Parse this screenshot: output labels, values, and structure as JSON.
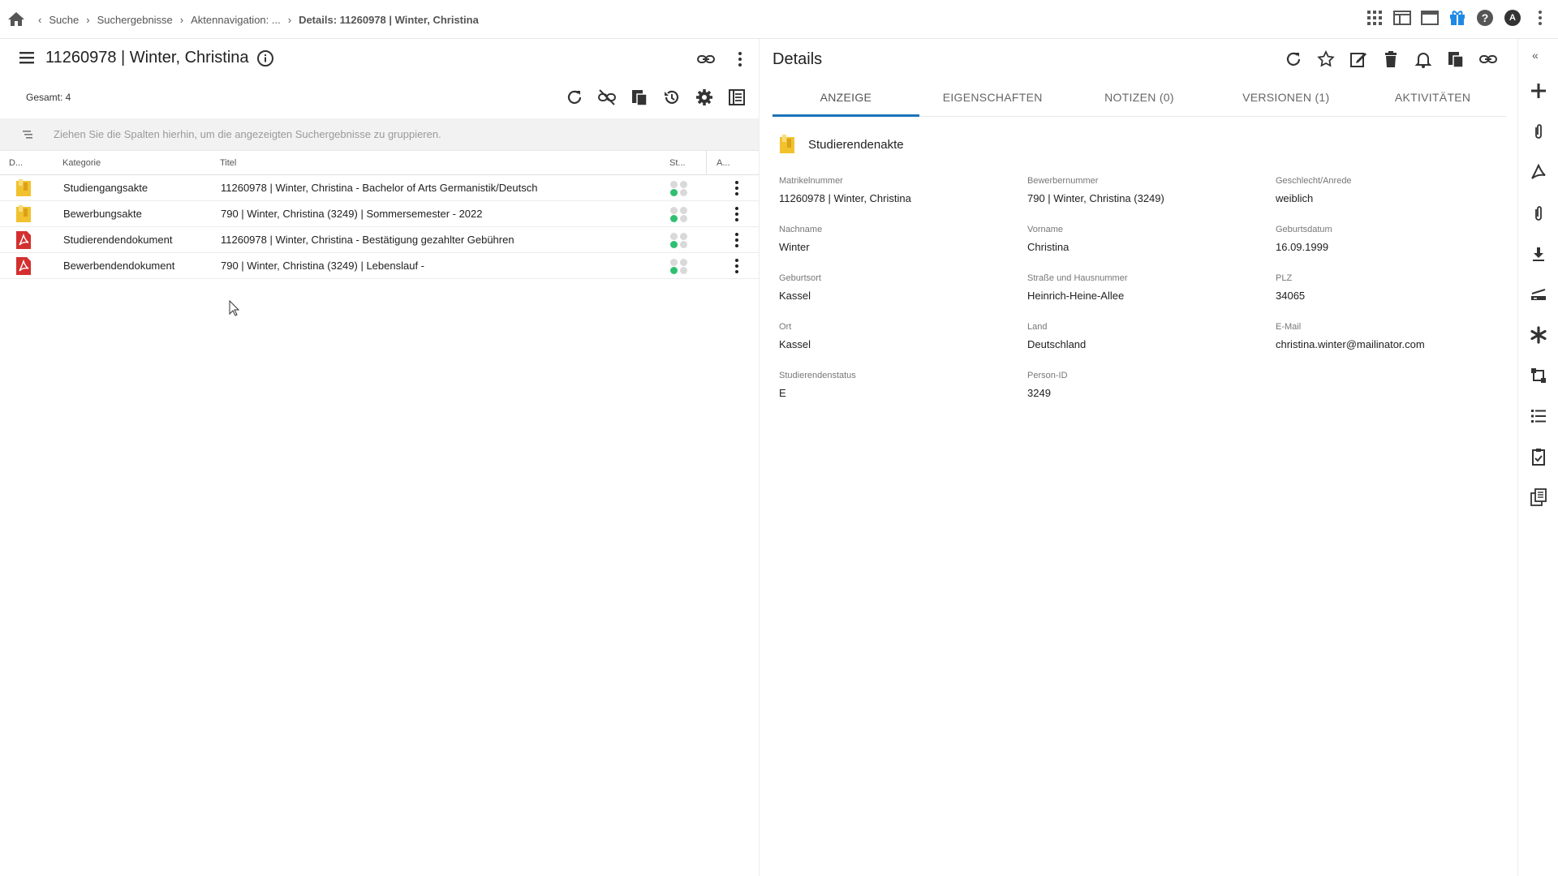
{
  "breadcrumb": {
    "items": [
      "Suche",
      "Suchergebnisse",
      "Aktennavigation: ...",
      "Details: 11260978 | Winter, Christina"
    ]
  },
  "top_icons": [
    "apps-icon",
    "layout-icon",
    "window-icon",
    "gift-icon",
    "help-icon",
    "user-avatar",
    "more-vert-icon"
  ],
  "user": {
    "avatar_letter": "A"
  },
  "left": {
    "title": "11260978 | Winter, Christina",
    "count_label": "Gesamt: 4",
    "group_hint": "Ziehen Sie die Spalten hierhin, um die angezeigten Suchergebnisse zu gruppieren.",
    "columns": {
      "d": "D...",
      "kategorie": "Kategorie",
      "titel": "Titel",
      "status": "St...",
      "actions": "A..."
    },
    "rows": [
      {
        "icon": "folder-icon",
        "kategorie": "Studiengangsakte",
        "titel": "11260978 | Winter, Christina - Bachelor of Arts Germanistik/Deutsch"
      },
      {
        "icon": "folder-icon",
        "kategorie": "Bewerbungsakte",
        "titel": "790 | Winter, Christina (3249) | Sommersemester - 2022"
      },
      {
        "icon": "pdf-icon",
        "kategorie": "Studierendendokument",
        "titel": "11260978 | Winter, Christina - Bestätigung gezahlter Gebühren"
      },
      {
        "icon": "pdf-icon",
        "kategorie": "Bewerbendendokument",
        "titel": "790 | Winter, Christina (3249) | Lebenslauf -"
      }
    ]
  },
  "right": {
    "title": "Details",
    "tabs": [
      "ANZEIGE",
      "EIGENSCHAFTEN",
      "NOTIZEN (0)",
      "VERSIONEN (1)",
      "AKTIVITÄTEN"
    ],
    "active_tab": "ANZEIGE",
    "doc_type": "Studierendenakte",
    "fields": [
      {
        "label": "Matrikelnummer",
        "value": "11260978 | Winter, Christina"
      },
      {
        "label": "Bewerbernummer",
        "value": "790 | Winter, Christina (3249)"
      },
      {
        "label": "Geschlecht/Anrede",
        "value": "weiblich"
      },
      {
        "label": "Nachname",
        "value": "Winter"
      },
      {
        "label": "Vorname",
        "value": "Christina"
      },
      {
        "label": "Geburtsdatum",
        "value": "16.09.1999"
      },
      {
        "label": "Geburtsort",
        "value": "Kassel"
      },
      {
        "label": "Straße und Hausnummer",
        "value": "Heinrich-Heine-Allee"
      },
      {
        "label": "PLZ",
        "value": "34065"
      },
      {
        "label": "Ort",
        "value": "Kassel"
      },
      {
        "label": "Land",
        "value": "Deutschland"
      },
      {
        "label": "E-Mail",
        "value": "christina.winter@mailinator.com"
      },
      {
        "label": "Studierendenstatus",
        "value": "E"
      },
      {
        "label": "Person-ID",
        "value": "3249"
      },
      {
        "label": "",
        "value": ""
      }
    ]
  },
  "colors": {
    "accent": "#1a73b8",
    "folder": "#f2c12e",
    "pdf": "#d32f2f",
    "status_green": "#2fbf71",
    "status_grey": "#d9d9d9",
    "gift": "#1e88e5"
  }
}
